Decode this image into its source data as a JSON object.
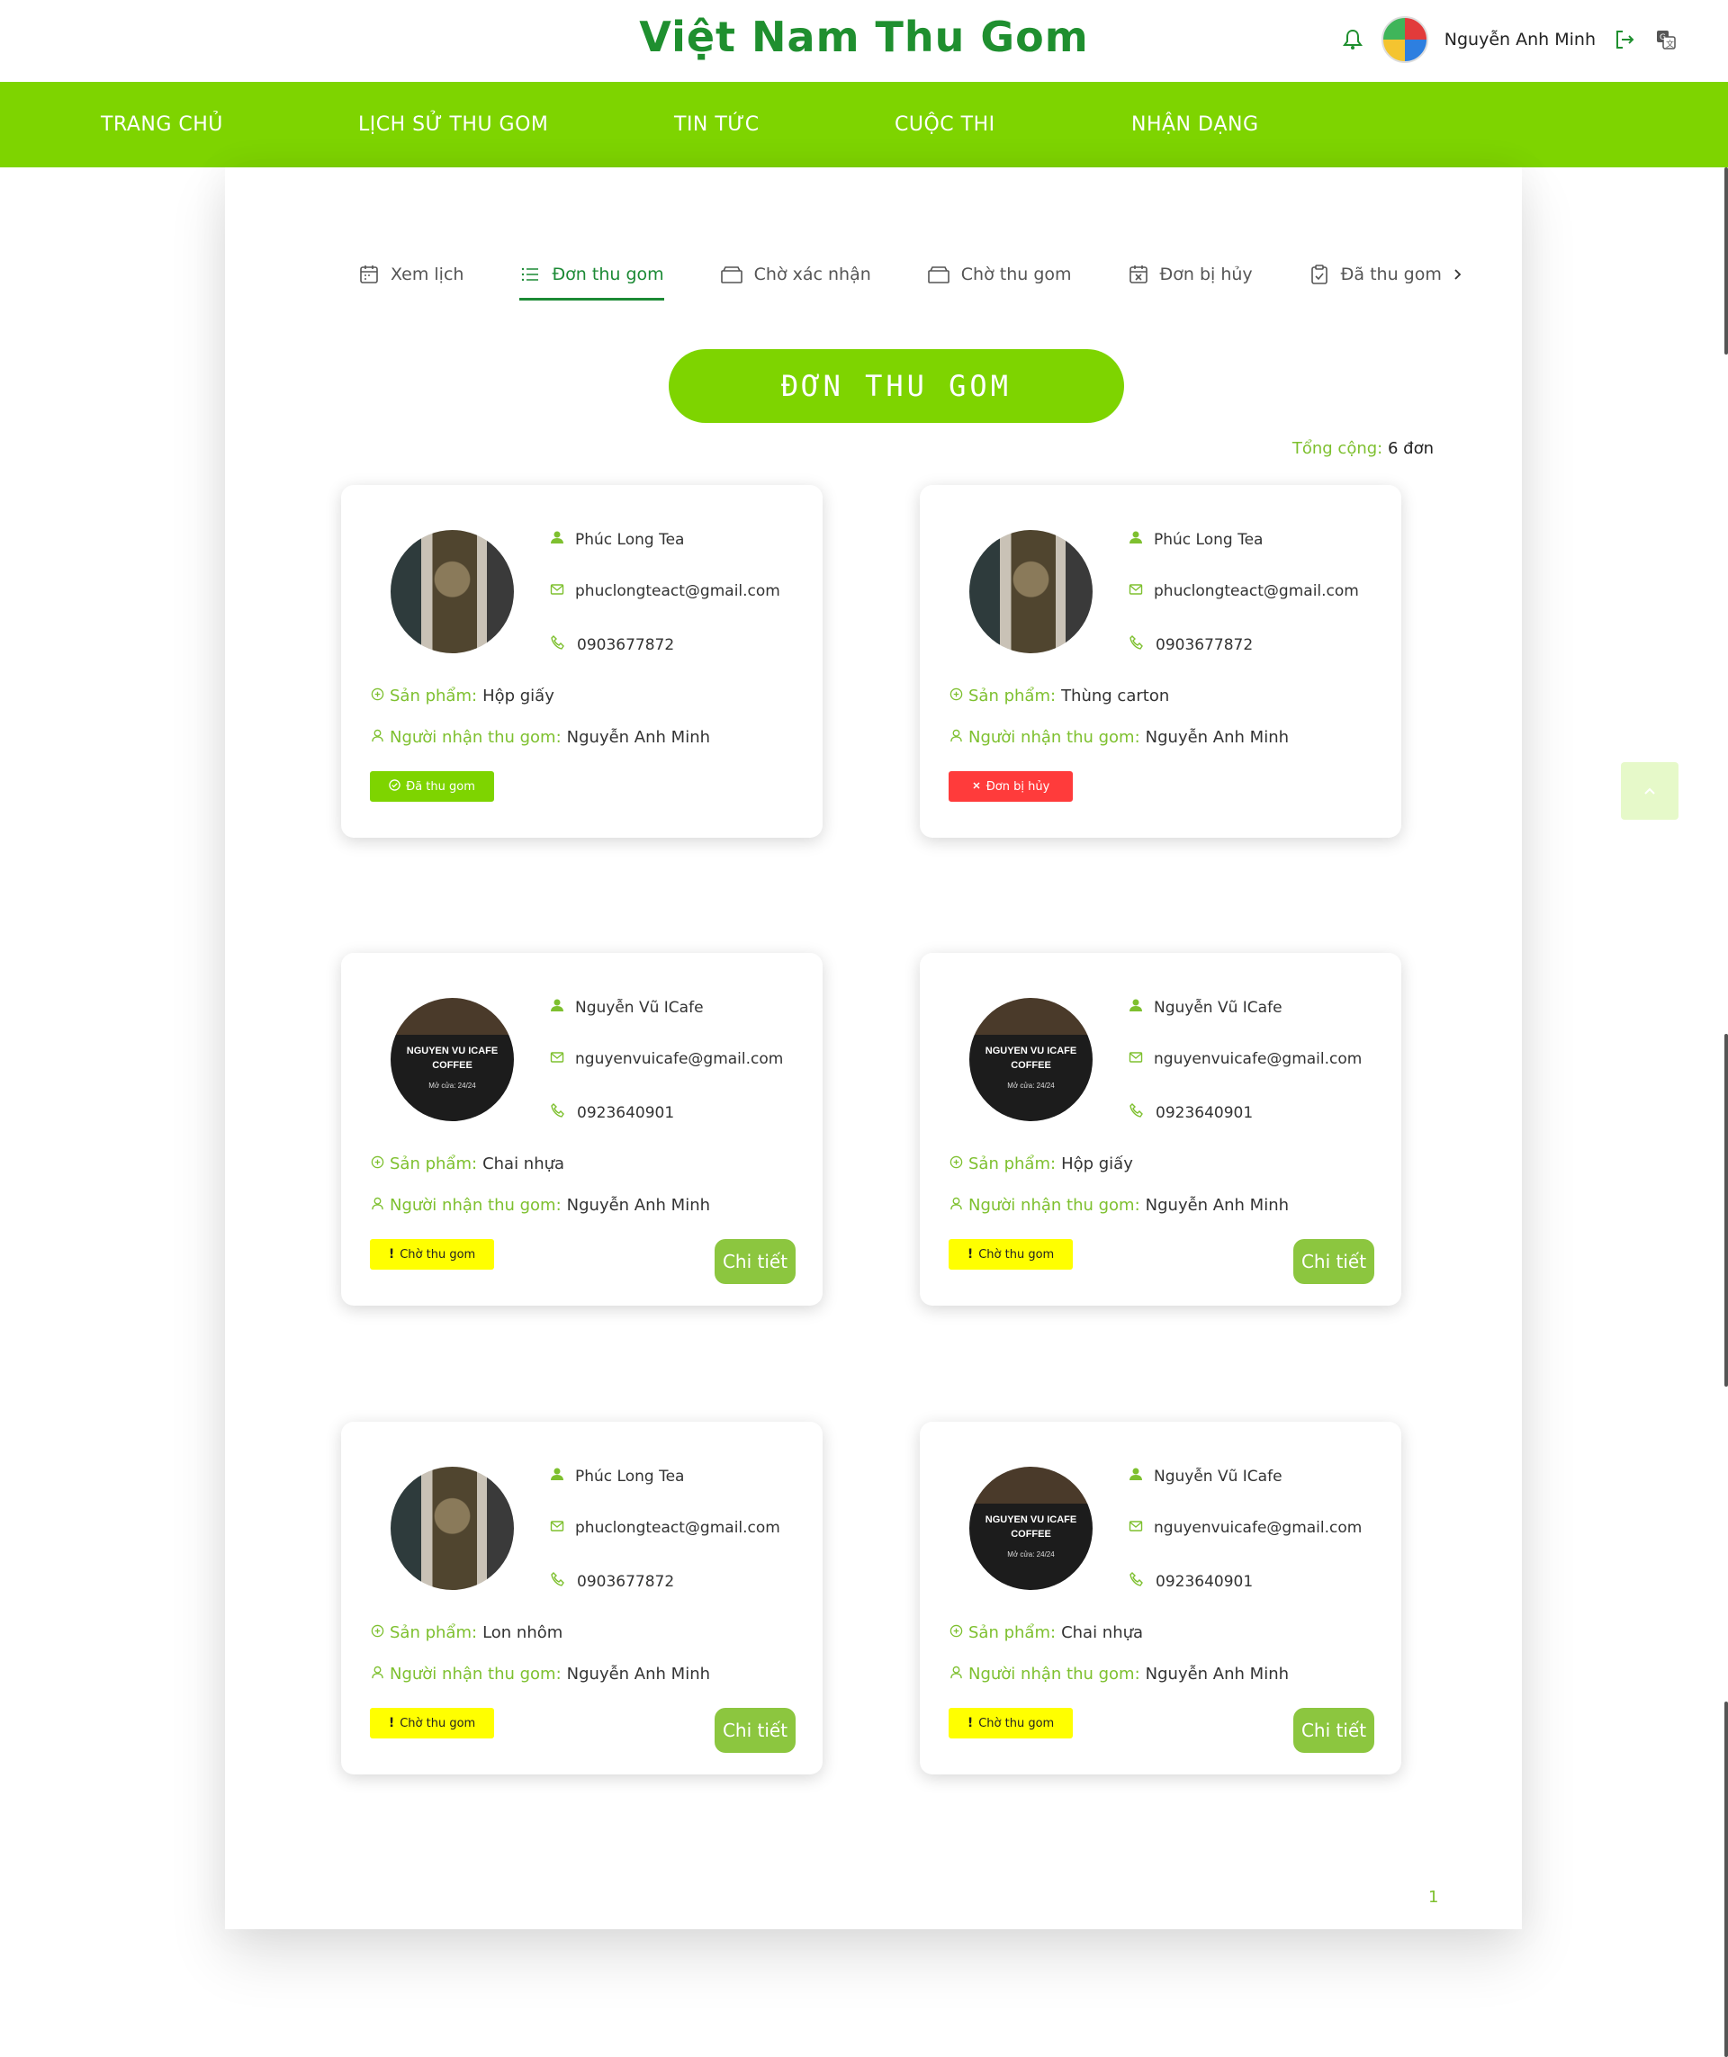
{
  "header": {
    "title": "Việt Nam Thu Gom",
    "user_name": "Nguyễn Anh Minh",
    "icons": [
      "bell-icon",
      "avatar",
      "logout-icon",
      "translate-icon"
    ]
  },
  "nav": {
    "items": [
      {
        "label": "TRANG CHỦ"
      },
      {
        "label": "LỊCH SỬ THU GOM"
      },
      {
        "label": "TIN TỨC"
      },
      {
        "label": "CUỘC THI"
      },
      {
        "label": "NHẬN DẠNG"
      }
    ]
  },
  "tabs": [
    {
      "label": "Xem lịch",
      "icon": "calendar-icon",
      "active": false
    },
    {
      "label": "Đơn thu gom",
      "icon": "list-icon",
      "active": true
    },
    {
      "label": "Chờ xác nhận",
      "icon": "box-icon",
      "active": false
    },
    {
      "label": "Chờ thu gom",
      "icon": "box-icon",
      "active": false
    },
    {
      "label": "Đơn bị hủy",
      "icon": "calendar-x-icon",
      "active": false
    },
    {
      "label": "Đã thu gom",
      "icon": "clipboard-check-icon",
      "active": false
    }
  ],
  "page": {
    "heading": "ĐƠN THU GOM",
    "total_label": "Tổng cộng:",
    "total_value": "6 đơn",
    "page_number": "1"
  },
  "labels": {
    "product": "Sản phẩm:",
    "receiver": "Người nhận thu gom:",
    "detail": "Chi tiết"
  },
  "orders": [
    {
      "store": "Phúc Long Tea",
      "email": "phuclongteact@gmail.com",
      "phone": "0903677872",
      "product": "Hộp giấy",
      "receiver": "Nguyễn Anh Minh",
      "status": "Đã thu gom",
      "status_type": "done",
      "has_detail": false
    },
    {
      "store": "Phúc Long Tea",
      "email": "phuclongteact@gmail.com",
      "phone": "0903677872",
      "product": "Thùng carton",
      "receiver": "Nguyễn Anh Minh",
      "status": "Đơn bị hủy",
      "status_type": "cancel",
      "has_detail": false
    },
    {
      "store": "Nguyễn Vũ ICafe",
      "email": "nguyenvuicafe@gmail.com",
      "phone": "0923640901",
      "product": "Chai nhựa",
      "receiver": "Nguyễn Anh Minh",
      "status": "Chờ thu gom",
      "status_type": "wait",
      "has_detail": true
    },
    {
      "store": "Nguyễn Vũ ICafe",
      "email": "nguyenvuicafe@gmail.com",
      "phone": "0923640901",
      "product": "Hộp giấy",
      "receiver": "Nguyễn Anh Minh",
      "status": "Chờ thu gom",
      "status_type": "wait",
      "has_detail": true
    },
    {
      "store": "Phúc Long Tea",
      "email": "phuclongteact@gmail.com",
      "phone": "0903677872",
      "product": "Lon nhôm",
      "receiver": "Nguyễn Anh Minh",
      "status": "Chờ thu gom",
      "status_type": "wait",
      "has_detail": true
    },
    {
      "store": "Nguyễn Vũ ICafe",
      "email": "nguyenvuicafe@gmail.com",
      "phone": "0923640901",
      "product": "Chai nhựa",
      "receiver": "Nguyễn Anh Minh",
      "status": "Chờ thu gom",
      "status_type": "wait",
      "has_detail": true
    }
  ],
  "store_photo_text": {
    "line1": "NGUYEN VU ICAFE",
    "line2": "COFFEE",
    "line3": "Mở cửa: 24/24"
  },
  "colors": {
    "brand_green": "#7ed400",
    "title_green": "#1f8f2f",
    "label_green": "#7ec02f",
    "detail_button": "#8cc63f",
    "cancel_red": "#ff3b3b",
    "wait_yellow": "#ffff00"
  }
}
